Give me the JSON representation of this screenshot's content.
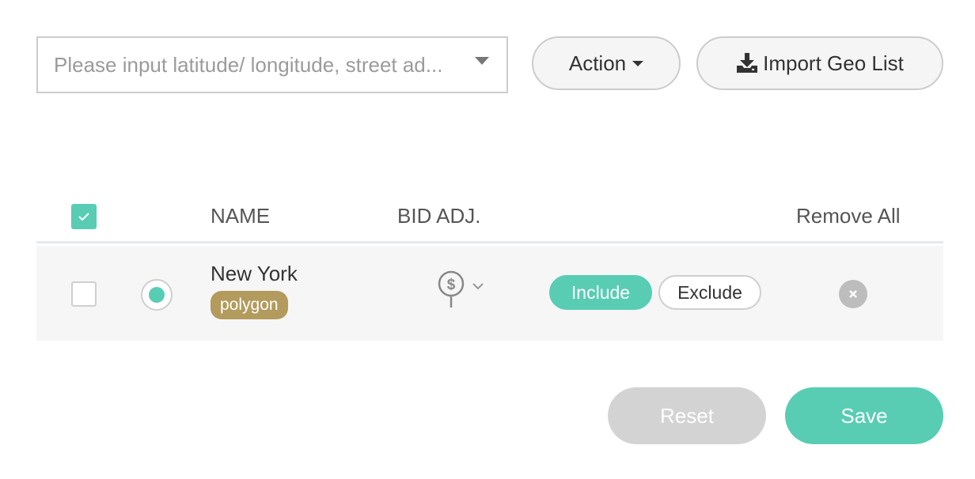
{
  "toolbar": {
    "search_placeholder": "Please input latitude/ longitude, street ad...",
    "action_label": "Action",
    "import_label": "Import Geo List"
  },
  "table": {
    "headers": {
      "name": "NAME",
      "bid_adj": "BID ADJ.",
      "remove_all": "Remove All"
    },
    "select_all_checked": true,
    "rows": [
      {
        "name": "New York",
        "tag": "polygon",
        "selected": false,
        "radio_selected": true,
        "include_label": "Include",
        "exclude_label": "Exclude",
        "mode": "Include"
      }
    ]
  },
  "footer": {
    "reset_label": "Reset",
    "save_label": "Save"
  },
  "colors": {
    "accent": "#58cdb4",
    "tag": "#b39b5d",
    "disabled": "#d3d3d3"
  },
  "icons": [
    "chevron-down-icon",
    "download-icon",
    "checkmark-icon",
    "dollar-pin-icon",
    "close-icon"
  ]
}
